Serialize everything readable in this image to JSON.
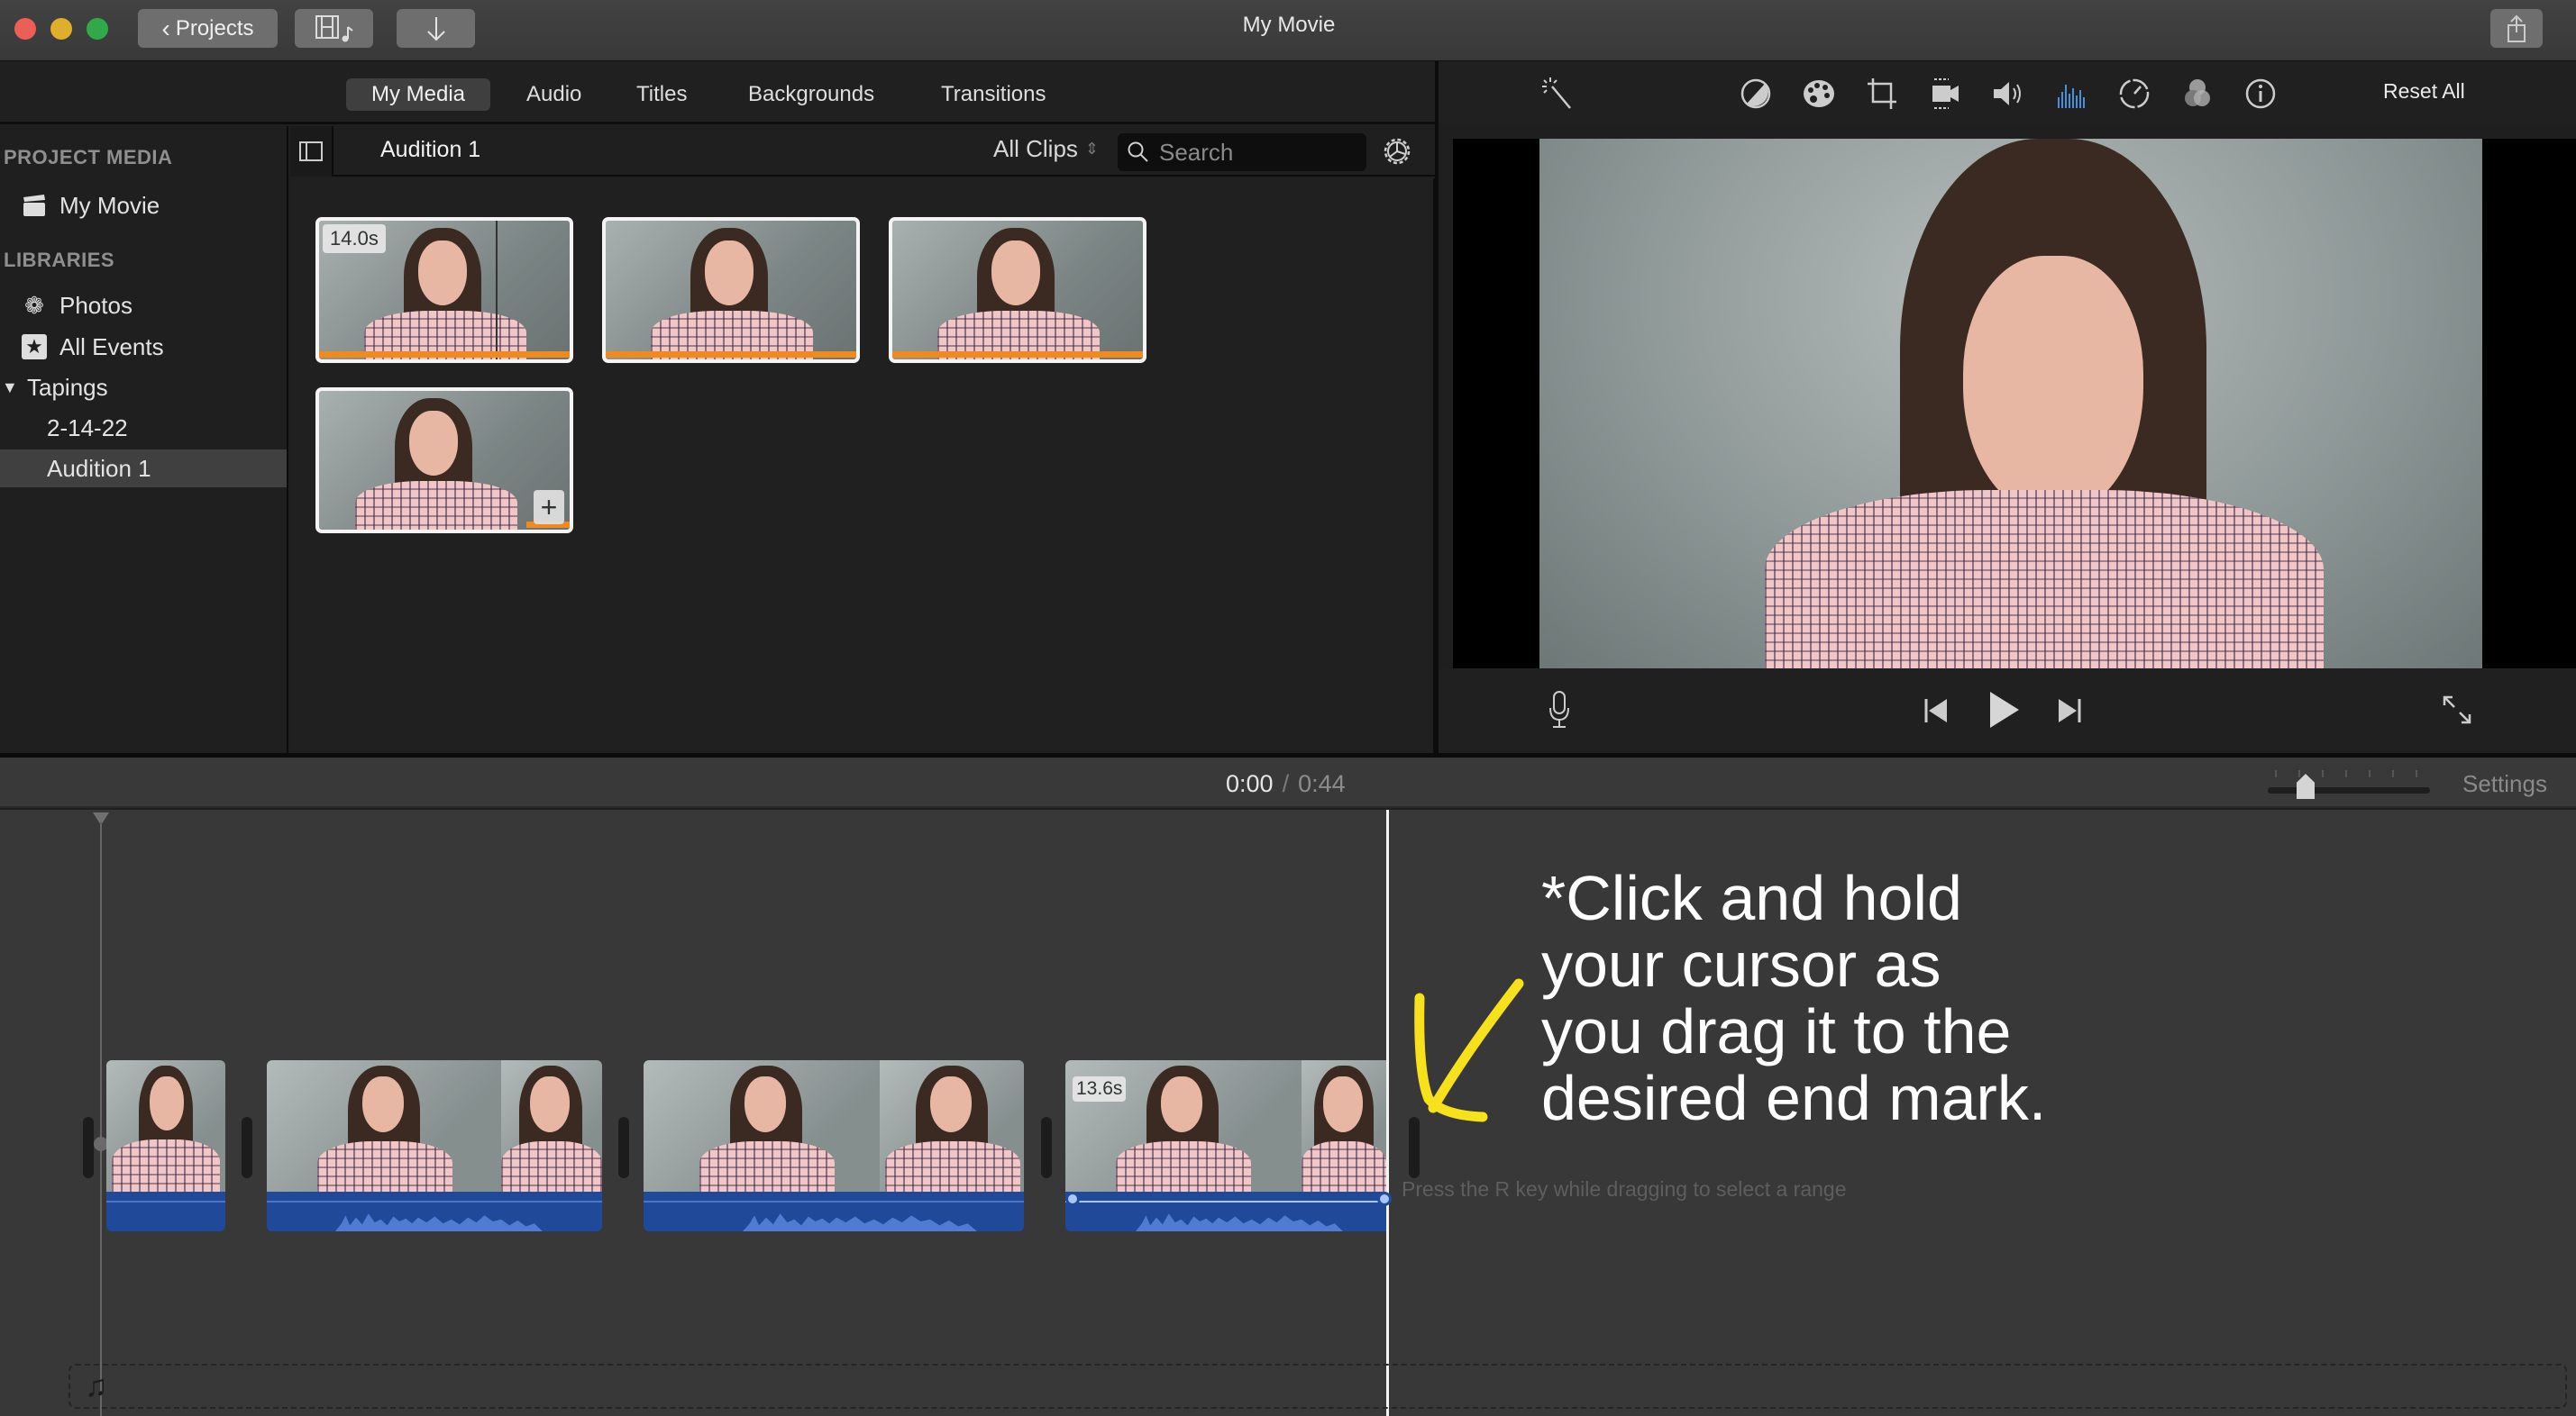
{
  "window": {
    "title": "My Movie",
    "traffic_lights": {
      "close": "#ec5f57",
      "minimize": "#dfae2b",
      "zoom": "#31a94a"
    }
  },
  "titlebar": {
    "back_button_label": "Projects",
    "back_icon": "chevron-left-icon",
    "media_toggle_icon": "film-music-icon",
    "import_icon": "arrow-down-icon",
    "share_icon": "share-icon"
  },
  "tabs": [
    {
      "label": "My Media",
      "active": true
    },
    {
      "label": "Audio",
      "active": false
    },
    {
      "label": "Titles",
      "active": false
    },
    {
      "label": "Backgrounds",
      "active": false
    },
    {
      "label": "Transitions",
      "active": false
    }
  ],
  "sidebar": {
    "project_media_heading": "PROJECT MEDIA",
    "project_items": [
      {
        "label": "My Movie",
        "icon": "clapperboard-icon"
      }
    ],
    "libraries_heading": "LIBRARIES",
    "library_items": [
      {
        "label": "Photos",
        "icon": "photos-flower-icon"
      },
      {
        "label": "All Events",
        "icon": "star-icon"
      }
    ],
    "library_group": {
      "label": "Tapings",
      "expanded": true,
      "disclosure_icon": "triangle-down-icon"
    },
    "events": [
      {
        "label": "2-14-22",
        "selected": false
      },
      {
        "label": "Audition 1",
        "selected": true
      }
    ]
  },
  "browser": {
    "event_title": "Audition 1",
    "filter": "All Clips",
    "search_placeholder": "Search",
    "clips": [
      {
        "duration_badge": "14.0s",
        "used_fraction": 1.0,
        "show_skimmer": true
      },
      {
        "duration_badge": "",
        "used_fraction": 1.0
      },
      {
        "duration_badge": "",
        "used_fraction": 1.0
      },
      {
        "duration_badge": "",
        "used_fraction": 0.15,
        "show_add": true
      }
    ],
    "add_icon": "plus-icon"
  },
  "viewer": {
    "toolbar_icons": [
      "magic-wand-icon",
      "color-balance-icon",
      "color-palette-icon",
      "crop-icon",
      "stabilization-icon",
      "volume-icon",
      "equalizer-icon",
      "speed-icon",
      "clip-filter-icon",
      "info-icon"
    ],
    "active_tool": "equalizer-icon",
    "reset_all_label": "Reset All",
    "accent_color": "#4a90d9"
  },
  "playback": {
    "voiceover_icon": "microphone-icon",
    "prev_icon": "skip-back-icon",
    "play_icon": "play-icon",
    "next_icon": "skip-forward-icon",
    "fullscreen_icon": "fullscreen-icon"
  },
  "timeline": {
    "current_time": "0:00",
    "separator": "/",
    "total_time": "0:44",
    "zoom_level": 0.2,
    "settings_label": "Settings",
    "clips": [
      {
        "duration_badge": "",
        "selected": false
      },
      {
        "duration_badge": "",
        "selected": false
      },
      {
        "duration_badge": "",
        "selected": false
      },
      {
        "duration_badge": "13.6s",
        "selected": true
      }
    ],
    "hint_text": "Press the R key while dragging to select a range",
    "music_icon": "music-note-icon"
  },
  "annotation": {
    "lines": [
      "*Click and hold",
      "your cursor as",
      "you drag it to the",
      "desired end mark."
    ],
    "arrow_color": "#f7e11a"
  }
}
